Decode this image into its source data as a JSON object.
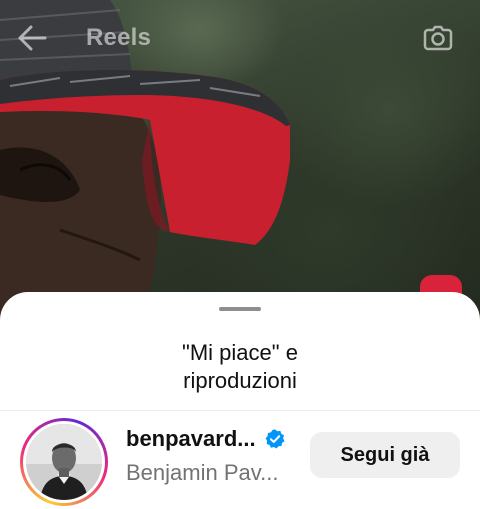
{
  "header": {
    "title": "Reels",
    "back_icon": "arrow-left-icon",
    "camera_icon": "camera-icon"
  },
  "sheet": {
    "title_line1": "\"Mi piace\" e",
    "title_line2": "riproduzioni"
  },
  "user": {
    "username": "benpavard...",
    "full_name": "Benjamin Pav...",
    "verified": true,
    "follow_label": "Segui già"
  },
  "colors": {
    "verified_blue": "#0095f6",
    "follow_button_bg": "#efefef",
    "sheet_bg": "#ffffff",
    "cap_red": "#c8202f"
  }
}
